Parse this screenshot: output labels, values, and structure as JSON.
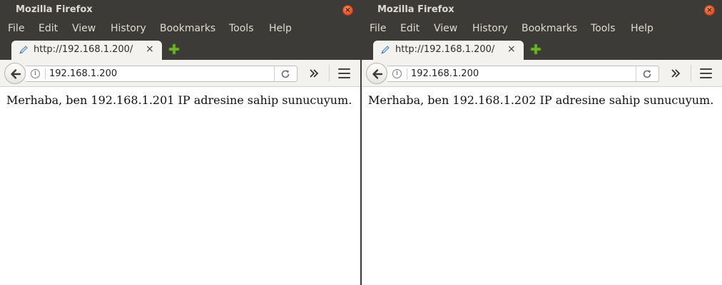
{
  "windows": [
    {
      "title": "Mozilla Firefox",
      "close_glyph": "×",
      "menu": [
        "File",
        "Edit",
        "View",
        "History",
        "Bookmarks",
        "Tools",
        "Help"
      ],
      "tab": {
        "label": "http://192.168.1.200/",
        "close_glyph": "×",
        "icon": "page-edit-icon"
      },
      "address": "192.168.1.200",
      "info_glyph": "i",
      "page_text": "Merhaba, ben 192.168.1.201 IP adresine sahip sunucuyum."
    },
    {
      "title": "Mozilla Firefox",
      "close_glyph": "×",
      "menu": [
        "File",
        "Edit",
        "View",
        "History",
        "Bookmarks",
        "Tools",
        "Help"
      ],
      "tab": {
        "label": "http://192.168.1.200/",
        "close_glyph": "×",
        "icon": "page-edit-icon"
      },
      "address": "192.168.1.200",
      "info_glyph": "i",
      "page_text": "Merhaba, ben 192.168.1.202 IP adresine sahip sunucuyum."
    }
  ],
  "colors": {
    "chrome_dark": "#3c3b37",
    "toolbar_light": "#f3f2ef",
    "close_orange": "#e0562a",
    "newtab_green": "#6fb52c"
  }
}
